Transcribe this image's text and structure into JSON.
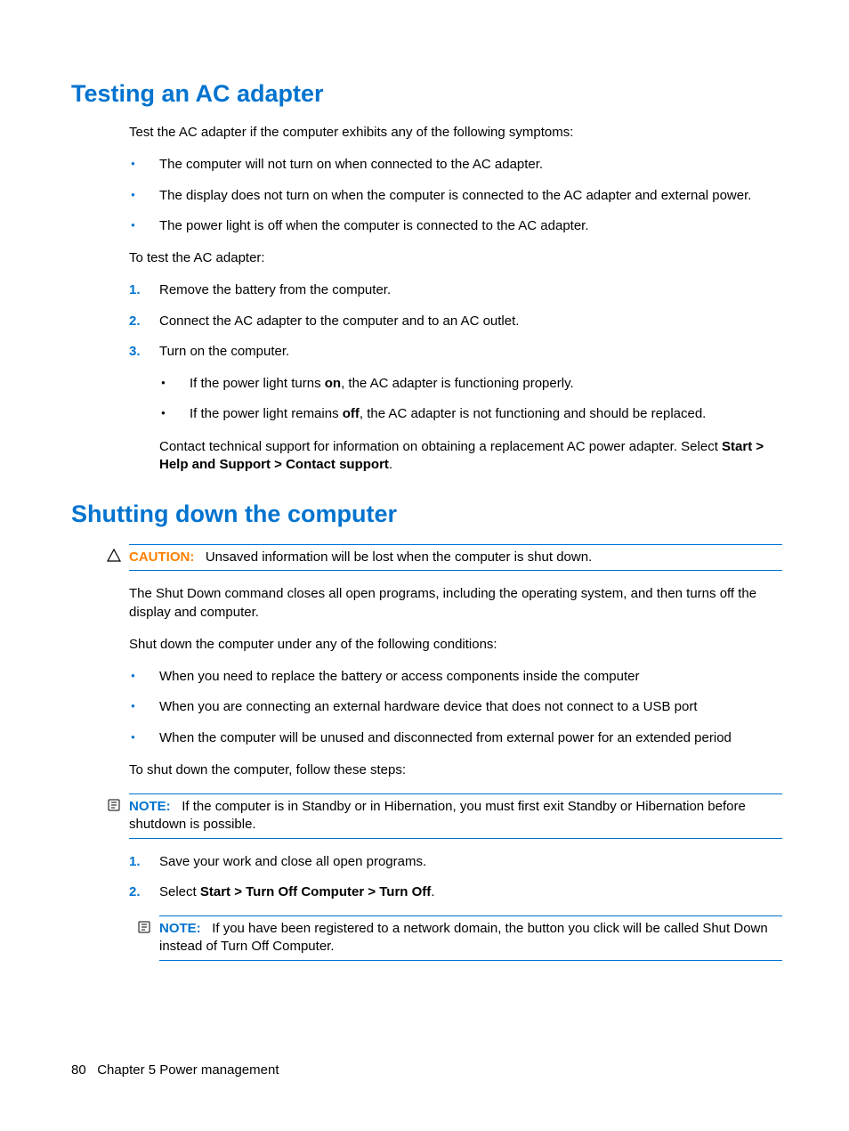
{
  "section1": {
    "heading": "Testing an AC adapter",
    "intro": "Test the AC adapter if the computer exhibits any of the following symptoms:",
    "bullets": [
      "The computer will not turn on when connected to the AC adapter.",
      "The display does not turn on when the computer is connected to the AC adapter and external power.",
      "The power light is off when the computer is connected to the AC adapter."
    ],
    "to_test": "To test the AC adapter:",
    "steps": [
      "Remove the battery from the computer.",
      "Connect the AC adapter to the computer and to an AC outlet.",
      "Turn on the computer."
    ],
    "sub_bullets": {
      "sb1_pre": "If the power light turns ",
      "sb1_bold": "on",
      "sb1_post": ", the AC adapter is functioning properly.",
      "sb2_pre": "If the power light remains ",
      "sb2_bold": "off",
      "sb2_post": ", the AC adapter is not functioning and should be replaced."
    },
    "contact_pre": "Contact technical support for information on obtaining a replacement AC power adapter. Select ",
    "contact_bold": "Start > Help and Support > Contact support",
    "contact_post": "."
  },
  "section2": {
    "heading": "Shutting down the computer",
    "caution_label": "CAUTION:",
    "caution_text": "Unsaved information will be lost when the computer is shut down.",
    "p1": "The Shut Down command closes all open programs, including the operating system, and then turns off the display and computer.",
    "p2": "Shut down the computer under any of the following conditions:",
    "bullets": [
      "When you need to replace the battery or access components inside the computer",
      "When you are connecting an external hardware device that does not connect to a USB port",
      "When the computer will be unused and disconnected from external power for an extended period"
    ],
    "p3": "To shut down the computer, follow these steps:",
    "note1_label": "NOTE:",
    "note1_text": "If the computer is in Standby or in Hibernation, you must first exit Standby or Hibernation before shutdown is possible.",
    "step1": "Save your work and close all open programs.",
    "step2_pre": "Select ",
    "step2_bold": "Start > Turn Off Computer > Turn Off",
    "step2_post": ".",
    "note2_label": "NOTE:",
    "note2_text": "If you have been registered to a network domain, the button you click will be called Shut Down instead of Turn Off Computer."
  },
  "footer": {
    "page_num": "80",
    "chapter": "Chapter 5   Power management"
  }
}
